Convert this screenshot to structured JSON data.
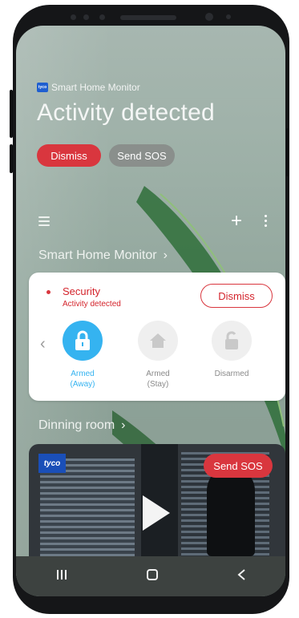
{
  "notification": {
    "app_name": "Smart Home Monitor",
    "app_badge": "tyco",
    "title": "Activity detected",
    "dismiss_label": "Dismiss",
    "sos_label": "Send SOS"
  },
  "home": {
    "section_title": "Smart Home Monitor",
    "card": {
      "security_label": "Security",
      "security_status": "Activity detected",
      "dismiss_label": "Dismiss",
      "modes": [
        {
          "line1": "Armed",
          "line2": "(Away)",
          "icon": "lock-icon",
          "active": true
        },
        {
          "line1": "Armed",
          "line2": "(Stay)",
          "icon": "home-icon",
          "active": false
        },
        {
          "line1": "Disarmed",
          "line2": "",
          "icon": "unlock-icon",
          "active": false
        }
      ]
    },
    "room_title": "Dinning room",
    "video": {
      "brand": "tyco",
      "sos_label": "Send SOS"
    }
  },
  "nav": [
    "recent-apps-icon",
    "home-button-icon",
    "back-icon"
  ],
  "colors": {
    "accent_red": "#d9363e",
    "accent_blue": "#35b3f0",
    "background_green": "#9db0a7"
  }
}
